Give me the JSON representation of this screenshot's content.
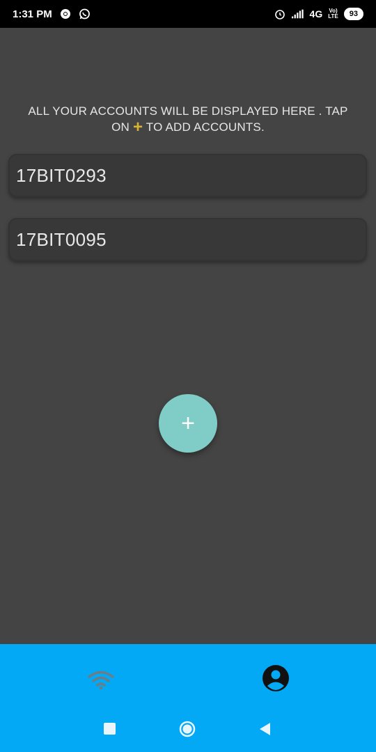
{
  "status_bar": {
    "time": "1:31 PM",
    "network": "4G",
    "volte_top": "Vo)",
    "volte_bottom": "LTE",
    "battery": "93"
  },
  "hint": {
    "line1": "ALL YOUR ACCOUNTS WILL BE DISPLAYED HERE . TAP",
    "line2_prefix": "ON",
    "plus": "+",
    "line2_suffix": "TO ADD ACCOUNTS."
  },
  "accounts": [
    {
      "label": "17BIT0293"
    },
    {
      "label": "17BIT0095"
    }
  ],
  "fab": {
    "icon": "+"
  },
  "bottom_nav": {
    "items": [
      {
        "icon": "wifi-icon"
      },
      {
        "icon": "account-circle-icon"
      }
    ]
  },
  "colors": {
    "background": "#444444",
    "card": "#383838",
    "fab": "#7fcdc6",
    "nav": "#03a9f4",
    "accent_plus": "#d8b232"
  }
}
